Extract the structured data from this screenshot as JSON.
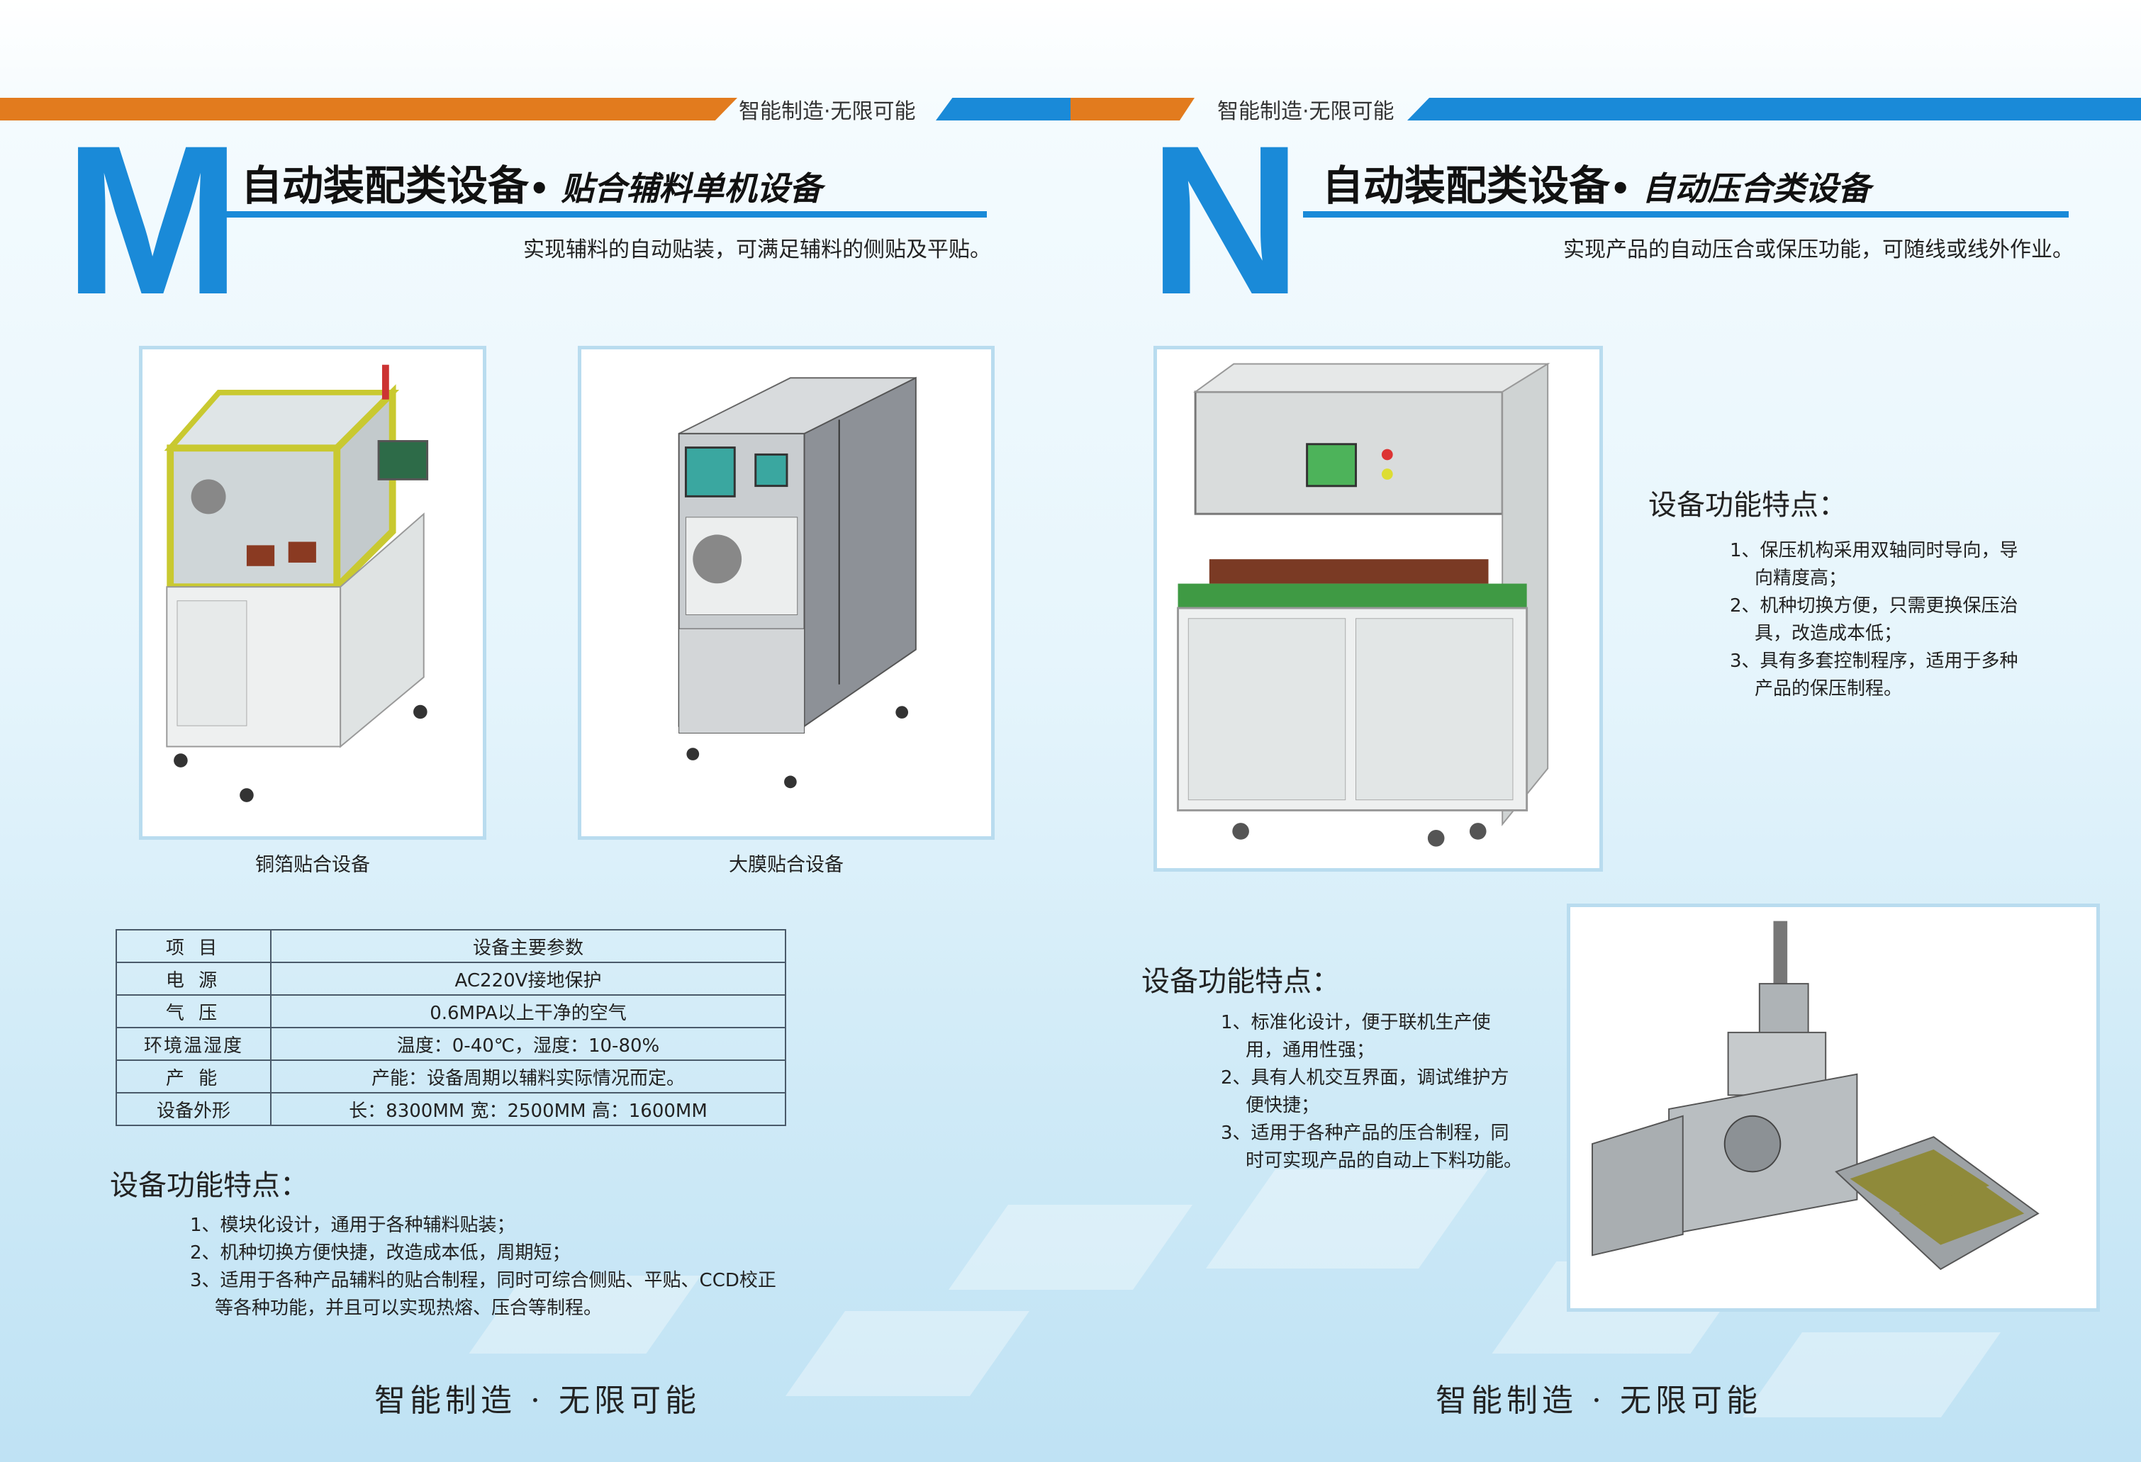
{
  "header": {
    "tagline_left": "智能制造·无限可能",
    "tagline_right": "智能制造·无限可能"
  },
  "colors": {
    "orange": "#e27b1e",
    "blue": "#1a8ad8"
  },
  "section_m": {
    "letter": "M",
    "title": "自动装配类设备",
    "subtitle": "• 贴合辅料单机设备",
    "desc": "实现辅料的自动贴装，可满足辅料的侧贴及平贴。",
    "photos": [
      {
        "caption": "铜箔贴合设备",
        "icon": "copper-foil-laminating-machine"
      },
      {
        "caption": "大膜贴合设备",
        "icon": "large-film-laminating-machine"
      }
    ],
    "spec_table": {
      "header": {
        "key": "项 目",
        "value": "设备主要参数"
      },
      "rows": [
        {
          "key": "电 源",
          "value": "AC220V接地保护"
        },
        {
          "key": "气 压",
          "value": "0.6MPA以上干净的空气"
        },
        {
          "key": "环境温湿度",
          "value": "温度：0-40℃，湿度：10-80%"
        },
        {
          "key": "产 能",
          "value": "产能：设备周期以辅料实际情况而定。"
        },
        {
          "key": "设备外形",
          "value": "长：8300MM 宽：2500MM 高：1600MM"
        }
      ]
    },
    "features_title": "设备功能特点：",
    "features": [
      "1、模块化设计，通用于各种辅料贴装；",
      "2、机种切换方便快捷，改造成本低，周期短；",
      "3、适用于各种产品辅料的贴合制程，同时可综合侧贴、平贴、CCD校正",
      "等各种功能，并且可以实现热熔、压合等制程。"
    ]
  },
  "section_n": {
    "letter": "N",
    "title": "自动装配类设备",
    "subtitle": "• 自动压合类设备",
    "desc": "实现产品的自动压合或保压功能，可随线或线外作业。",
    "features1_title": "设备功能特点：",
    "features1": [
      "1、保压机构采用双轴同时导向，导",
      "向精度高；",
      "2、机种切换方便，只需更换保压治",
      "具，改造成本低；",
      "3、具有多套控制程序，适用于多种",
      "产品的保压制程。"
    ],
    "features2_title": "设备功能特点：",
    "features2": [
      "1、标准化设计，便于联机生产使",
      "用，通用性强；",
      "2、具有人机交互界面，调试维护方",
      "便快捷；",
      "3、适用于各种产品的压合制程，同",
      "时可实现产品的自动上下料功能。"
    ]
  },
  "footer": {
    "slogan_left": "智能制造 · 无限可能",
    "slogan_right": "智能制造 · 无限可能"
  }
}
